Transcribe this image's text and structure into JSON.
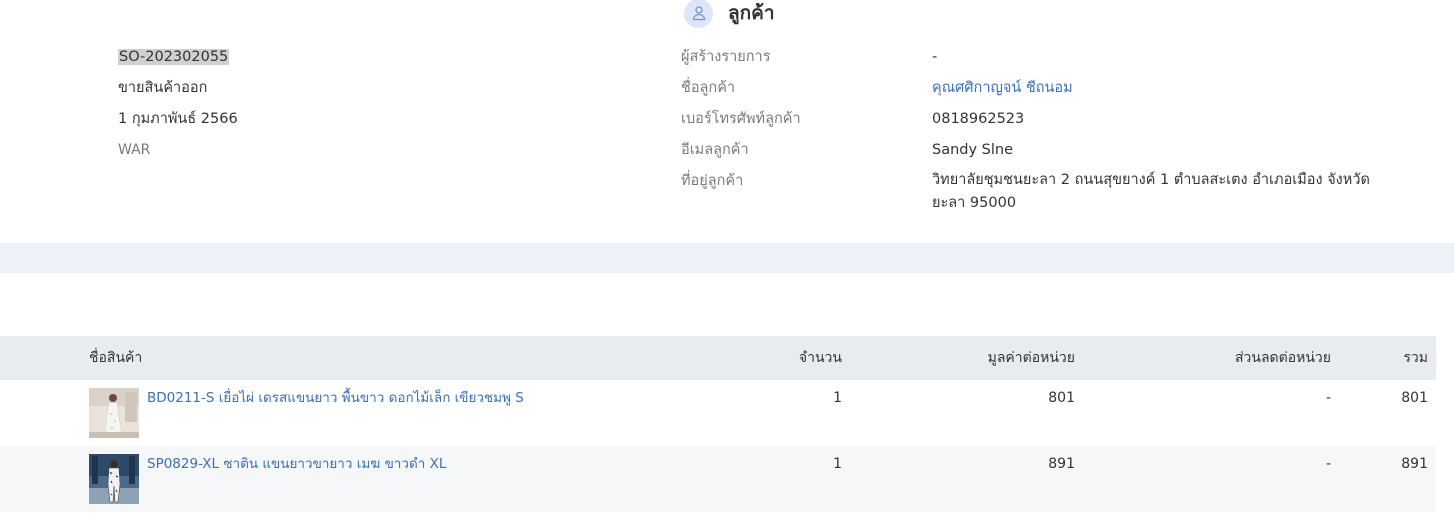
{
  "customer_section": {
    "title": "ลูกค้า"
  },
  "document": {
    "order_no": "SO-202302055",
    "type": "ขายสินค้าออก",
    "date": "1 กุมภาพันธ์ 2566",
    "warehouse": "WAR"
  },
  "customer": {
    "labels": {
      "creator": "ผู้สร้างรายการ",
      "name": "ชื่อลูกค้า",
      "phone": "เบอร์โทรศัพท์ลูกค้า",
      "email": "อีเมลลูกค้า",
      "address": "ที่อยู่ลูกค้า"
    },
    "values": {
      "creator": "-",
      "name": "คุณศศิกาญจน์ ชีถนอม",
      "phone": "0818962523",
      "email": "Sandy Slne",
      "address": "วิทยาลัยชุมชนยะลา 2 ถนนสุขยางค์ 1 ตำบลสะเตง อำเภอเมือง จังหวัดยะลา 95000"
    }
  },
  "table": {
    "headers": {
      "product": "ชื่อสินค้า",
      "qty": "จำนวน",
      "unit_price": "มูลค่าต่อหน่วย",
      "unit_discount": "ส่วนลดต่อหน่วย",
      "total": "รวม"
    },
    "rows": [
      {
        "name": "BD0211-S เยื่อไผ่ เดรสแขนยาว พื้นขาว ดอกไม้เล็ก เขียวชมพู S",
        "qty": "1",
        "unit_price": "801",
        "unit_discount": "-",
        "total": "801"
      },
      {
        "name": "SP0829-XL ซาติน แขนยาวขายาว เมฆ ขาวดำ XL",
        "qty": "1",
        "unit_price": "891",
        "unit_discount": "-",
        "total": "891"
      }
    ]
  },
  "colors": {
    "link": "#3b6fb6",
    "header_bg": "#e8ebef",
    "band_bg": "#eef1f8",
    "alt_row_bg": "#f6f7f9",
    "avatar_bg": "#dde6f8"
  }
}
